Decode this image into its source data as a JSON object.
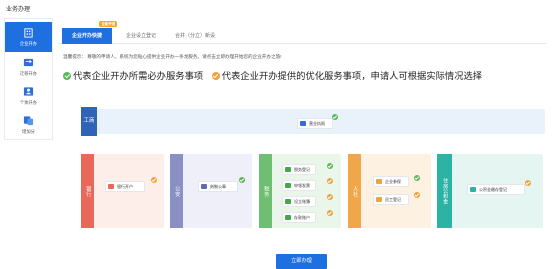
{
  "app": {
    "title": "业务办理"
  },
  "sidebar": {
    "items": [
      {
        "label": "企业开办",
        "icon": "building-icon",
        "active": true
      },
      {
        "label": "迁移开办",
        "icon": "transfer-icon",
        "active": false
      },
      {
        "label": "个体开办",
        "icon": "person-icon",
        "active": false
      },
      {
        "label": "增加分",
        "icon": "branch-icon",
        "active": false
      }
    ]
  },
  "tabs": [
    {
      "label": "企业开办快捷",
      "badge": "全新开通",
      "active": true
    },
    {
      "label": "企业设立登记",
      "active": false
    },
    {
      "label": "合并（分立）新设",
      "active": false
    }
  ],
  "hint": "温馨提示：  尊敬的申请人，系统为您贴心提供企业开办一条龙服务。请点击立即办理开始您的企业开办之旅!",
  "legend": {
    "required": "代表企业开办所需必办服务事项",
    "optional": "代表企业开办提供的优化服务事项，申请人可根据实际情况选择"
  },
  "colors": {
    "primary": "#1e6fe0",
    "green": "#5cb85c",
    "orange": "#f0a33c",
    "gongshang": "#2f63b8",
    "bank": "#e8685a",
    "gongan": "#8a8fc4",
    "shuiwu": "#6fbf73",
    "renshe": "#f2a64a",
    "gongjijin": "#2bb3a3"
  },
  "flow": {
    "gongshang": {
      "label": "工商",
      "item": "营业执照"
    },
    "bank": {
      "label": "银行",
      "item": "银行开户"
    },
    "gongan": {
      "label": "公安",
      "item": "刻制公章"
    },
    "shuiwu": {
      "label": "税务",
      "items": [
        "税务登记",
        "申领发票",
        "设立账簿",
        "存款账户"
      ]
    },
    "renshe": {
      "label": "人社",
      "items": [
        "企业参保",
        "员工登记"
      ]
    },
    "gongjijin": {
      "label": "住房公积金",
      "item": "公积金缴存登记"
    }
  },
  "submit": {
    "label": "立即办理"
  }
}
